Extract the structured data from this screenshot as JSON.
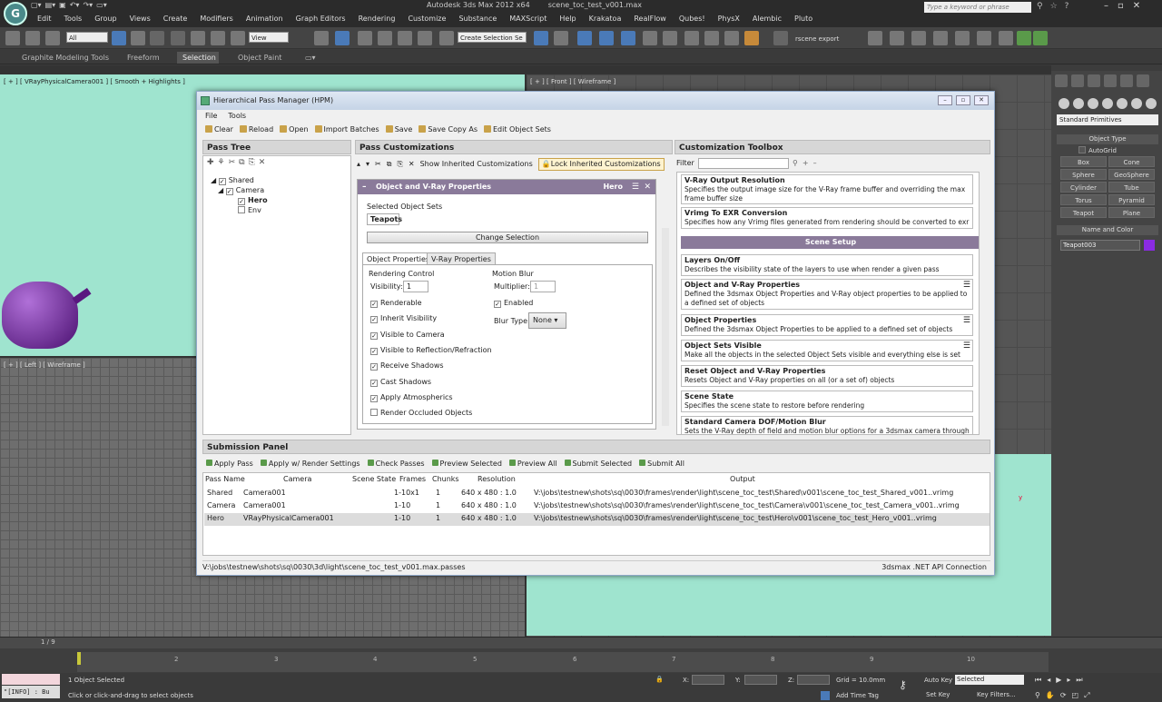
{
  "app": {
    "title": "Autodesk 3ds Max  2012 x64",
    "file": "scene_toc_test_v001.max",
    "logo": "G",
    "search_placeholder": "Type a keyword or phrase"
  },
  "menu": [
    "Edit",
    "Tools",
    "Group",
    "Views",
    "Create",
    "Modifiers",
    "Animation",
    "Graph Editors",
    "Rendering",
    "Customize",
    "Substance",
    "MAXScript",
    "Help",
    "Krakatoa",
    "RealFlow",
    "Qubes!",
    "PhysX",
    "Alembic",
    "Pluto"
  ],
  "toolbar": {
    "filter_select": "All",
    "view_select": "View",
    "selection_set": "Create Selection Se",
    "export_label": "rscene export"
  },
  "ribbon": {
    "tabs": [
      "Graphite Modeling Tools",
      "Freeform",
      "Selection",
      "Object Paint"
    ],
    "active": "Selection"
  },
  "viewports": {
    "top_left": "[ + ] [ VRayPhysicalCamera001 ] [ Smooth + Highlights ]",
    "top_right": "[ + ] [ Front ] [ Wireframe ]",
    "bottom_left": "[ + ] [ Left ] [ Wireframe ]",
    "axis_y": "y"
  },
  "command_panel": {
    "primitive_select": "Standard Primitives",
    "object_type_header": "Object Type",
    "autogrid": "AutoGrid",
    "objects": [
      "Box",
      "Cone",
      "Sphere",
      "GeoSphere",
      "Cylinder",
      "Tube",
      "Torus",
      "Pyramid",
      "Teapot",
      "Plane"
    ],
    "name_color_header": "Name and Color",
    "name_value": "Teapot003",
    "swatch_color": "#8a2be2"
  },
  "hpm": {
    "title": "Hierarchical Pass Manager (HPM)",
    "menu": [
      "File",
      "Tools"
    ],
    "toolbar": [
      "Clear",
      "Reload",
      "Open",
      "Import Batches",
      "Save",
      "Save Copy As",
      "Edit Object Sets"
    ],
    "pass_tree": {
      "header": "Pass Tree",
      "items": [
        {
          "label": "Shared",
          "checked": "✓"
        },
        {
          "label": "Camera",
          "checked": "✓"
        },
        {
          "label": "Hero",
          "checked": "✓"
        },
        {
          "label": "Env",
          "checked": ""
        }
      ]
    },
    "pass_customizations": {
      "header": "Pass Customizations",
      "show_inherited": "Show Inherited Customizations",
      "lock_inherited": "Lock Inherited Customizations",
      "card_title": "Object and V-Ray Properties",
      "card_pass": "Hero",
      "selected_sets_label": "Selected Object Sets",
      "selected_set": "Teapots",
      "change_selection": "Change Selection",
      "tabs": [
        "Object Properties",
        "V-Ray Properties"
      ],
      "rendering_control": "Rendering Control",
      "visibility_label": "Visibility:",
      "visibility_value": "1",
      "checkboxes": [
        {
          "label": "Renderable",
          "checked": "✓"
        },
        {
          "label": "Inherit Visibility",
          "checked": "✓"
        },
        {
          "label": "Visible to Camera",
          "checked": "✓"
        },
        {
          "label": "Visible to Reflection/Refraction",
          "checked": "✓"
        },
        {
          "label": "Receive Shadows",
          "checked": "✓"
        },
        {
          "label": "Cast Shadows",
          "checked": "✓"
        },
        {
          "label": "Apply Atmospherics",
          "checked": "✓"
        },
        {
          "label": "Render Occluded Objects",
          "checked": ""
        }
      ],
      "motion_blur": "Motion Blur",
      "multiplier_label": "Multiplier:",
      "multiplier_value": "1",
      "enabled_label": "Enabled",
      "enabled_checked": "✓",
      "blur_type_label": "Blur Type:",
      "blur_type_value": "None"
    },
    "toolbox": {
      "header": "Customization Toolbox",
      "filter_label": "Filter",
      "top_items": [
        {
          "title": "V-Ray Output Resolution",
          "desc": "Specifies the output image size for the V-Ray frame buffer and overriding the max frame buffer size"
        },
        {
          "title": "Vrimg To EXR Conversion",
          "desc": "Specifies how any Vrimg files generated from rendering should be converted to exr"
        }
      ],
      "scene_setup": "Scene Setup",
      "items": [
        {
          "title": "Layers On/Off",
          "desc": "Describes the visibility state of the layers to use when render a given pass"
        },
        {
          "title": "Object and V-Ray Properties",
          "desc": "Defined the 3dsmax Object Properties and V-Ray object properties to be applied to a defined set of objects"
        },
        {
          "title": "Object Properties",
          "desc": "Defined the 3dsmax Object Properties to be applied to a defined set of objects"
        },
        {
          "title": "Object Sets Visible",
          "desc": "Make all the objects in the selected Object Sets visible and everything else is set not-visible"
        },
        {
          "title": "Reset Object and V-Ray Properties",
          "desc": "Resets Object and V-Ray properties on all (or a set of) objects"
        },
        {
          "title": "Scene State",
          "desc": "Specifies the scene state to restore before rendering"
        },
        {
          "title": "Standard Camera DOF/Motion Blur",
          "desc": "Sets the V-Ray depth of field and motion blur options for a 3dsmax camera through V-Ray"
        }
      ]
    },
    "submission": {
      "header": "Submission Panel",
      "toolbar": [
        "Apply Pass",
        "Apply w/ Render Settings",
        "Check Passes",
        "Preview Selected",
        "Preview All",
        "Submit Selected",
        "Submit All"
      ],
      "columns": [
        "Pass Name",
        "Camera",
        "Scene State",
        "Frames",
        "Chunks",
        "Resolution",
        "Output"
      ],
      "rows": [
        [
          "Shared",
          "Camera001",
          "",
          "1-10x1",
          "1",
          "640 x 480 : 1.0",
          "V:\\jobs\\testnew\\shots\\sq\\0030\\frames\\render\\light\\scene_toc_test\\Shared\\v001\\scene_toc_test_Shared_v001..vrimg"
        ],
        [
          "Camera",
          "Camera001",
          "",
          "1-10",
          "1",
          "640 x 480 : 1.0",
          "V:\\jobs\\testnew\\shots\\sq\\0030\\frames\\render\\light\\scene_toc_test\\Camera\\v001\\scene_toc_test_Camera_v001..vrimg"
        ],
        [
          "Hero",
          "VRayPhysicalCamera001",
          "",
          "1-10",
          "1",
          "640 x 480 : 1.0",
          "V:\\jobs\\testnew\\shots\\sq\\0030\\frames\\render\\light\\scene_toc_test\\Hero\\v001\\scene_toc_test_Hero_v001..vrimg"
        ]
      ]
    },
    "footer_path": "V:\\jobs\\testnew\\shots\\sq\\0030\\3d\\light\\scene_toc_test_v001.max.passes",
    "footer_status": "3dsmax .NET API Connection"
  },
  "timeline": {
    "frame": "1 / 9",
    "ticks": [
      "2",
      "3",
      "4",
      "5",
      "6",
      "7",
      "8",
      "9",
      "10"
    ]
  },
  "status": {
    "maxscript": "\"[INFO] : Bu",
    "selected": "1 Object Selected",
    "prompt": "Click or click-and-drag to select objects",
    "x_label": "X:",
    "y_label": "Y:",
    "z_label": "Z:",
    "grid": "Grid = 10.0mm",
    "add_time_tag": "Add Time Tag",
    "auto_key": "Auto Key",
    "set_key": "Set Key",
    "selected_select": "Selected",
    "key_filters": "Key Filters..."
  }
}
